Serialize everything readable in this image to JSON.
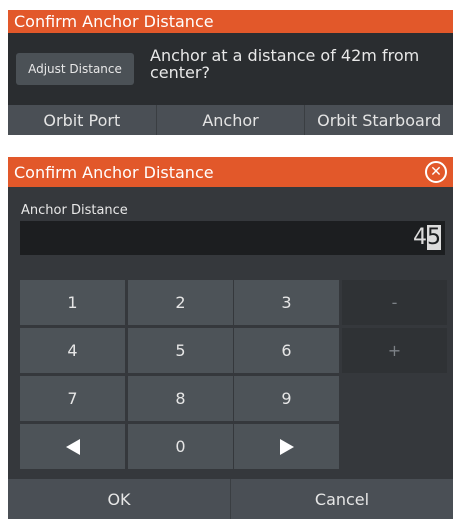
{
  "confirm_panel": {
    "title": "Confirm Anchor Distance",
    "adjust_label": "Adjust Distance",
    "message": "Anchor at a distance of 42m from center?",
    "actions": [
      "Orbit Port",
      "Anchor",
      "Orbit Starboard"
    ]
  },
  "dialog": {
    "title": "Confirm Anchor Distance",
    "field_label": "Anchor Distance",
    "value_prefix": "4",
    "value_cursor": "5",
    "keys": {
      "k1": "1",
      "k2": "2",
      "k3": "3",
      "minus": "-",
      "k4": "4",
      "k5": "5",
      "k6": "6",
      "plus": "+",
      "k7": "7",
      "k8": "8",
      "k9": "9",
      "k0": "0"
    },
    "ok_label": "OK",
    "cancel_label": "Cancel"
  },
  "colors": {
    "accent": "#e2582a",
    "panel": "#35383c",
    "key": "#4d5358"
  },
  "icons": [
    "close-icon",
    "left-arrow-icon",
    "right-arrow-icon"
  ]
}
